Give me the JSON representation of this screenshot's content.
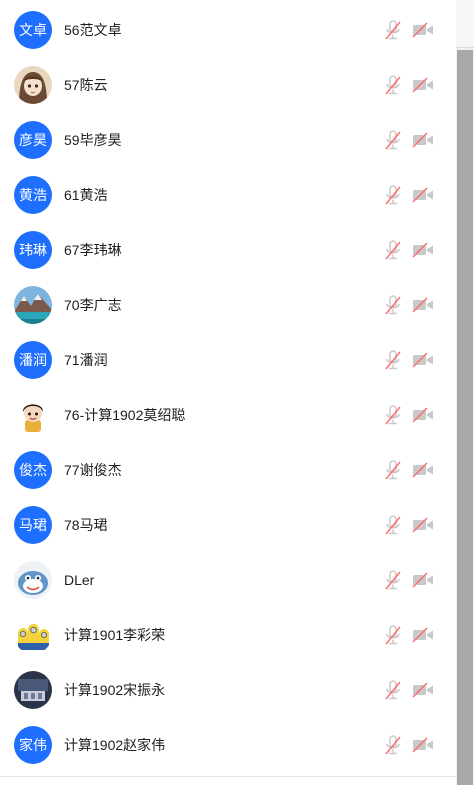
{
  "participants": [
    {
      "name": "56范文卓",
      "avatar_type": "text",
      "avatar_text": "文卓"
    },
    {
      "name": "57陈云",
      "avatar_type": "image",
      "avatar_icon": "anime-girl-avatar"
    },
    {
      "name": "59毕彦昊",
      "avatar_type": "text",
      "avatar_text": "彦昊"
    },
    {
      "name": "61黄浩",
      "avatar_type": "text",
      "avatar_text": "黄浩"
    },
    {
      "name": "67李玮琳",
      "avatar_type": "text",
      "avatar_text": "玮琳"
    },
    {
      "name": "70李广志",
      "avatar_type": "image",
      "avatar_icon": "mountain-lake-avatar"
    },
    {
      "name": "71潘润",
      "avatar_type": "text",
      "avatar_text": "潘润"
    },
    {
      "name": "76-计算1902莫绍聪",
      "avatar_type": "image",
      "avatar_icon": "cartoon-boy-avatar"
    },
    {
      "name": "77谢俊杰",
      "avatar_type": "text",
      "avatar_text": "俊杰"
    },
    {
      "name": "78马珺",
      "avatar_type": "text",
      "avatar_text": "马珺"
    },
    {
      "name": "DLer",
      "avatar_type": "image",
      "avatar_icon": "cartoon-creature-avatar"
    },
    {
      "name": "计算1901李彩荣",
      "avatar_type": "image",
      "avatar_icon": "minions-avatar"
    },
    {
      "name": "计算1902宋振永",
      "avatar_type": "image",
      "avatar_icon": "dark-photo-avatar"
    },
    {
      "name": "计算1902赵家伟",
      "avatar_type": "text",
      "avatar_text": "家伟"
    }
  ],
  "status_icons": {
    "mic": "mic-muted-icon",
    "camera": "camera-off-icon"
  },
  "colors": {
    "avatar_bg": "#1e6fff",
    "muted_slash": "#ff6a6a",
    "icon_gray": "#c9c9c9"
  }
}
